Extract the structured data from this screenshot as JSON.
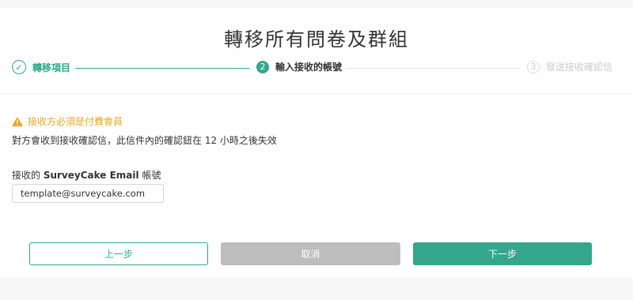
{
  "page": {
    "title": "轉移所有問卷及群組"
  },
  "steps": [
    {
      "number": "✓",
      "label": "轉移項目",
      "state": "done"
    },
    {
      "number": "2",
      "label": "輸入接收的帳號",
      "state": "active"
    },
    {
      "number": "3",
      "label": "發送接收確認信",
      "state": "pending"
    }
  ],
  "notice": {
    "warning": "接收方必須是付費會員",
    "description": "對方會收到接收確認信，此信件內的確認鈕在 12 小時之後失效",
    "icon": "warning-icon"
  },
  "field": {
    "label_prefix": "接收的 ",
    "label_brand": "SurveyCake Email",
    "label_suffix": " 帳號",
    "value": "template@surveycake.com"
  },
  "buttons": {
    "prev": "上一步",
    "cancel": "取消",
    "next": "下一步"
  },
  "colors": {
    "accent": "#33a68b",
    "warning": "#f0a428",
    "disabled": "#bdbdbd"
  }
}
